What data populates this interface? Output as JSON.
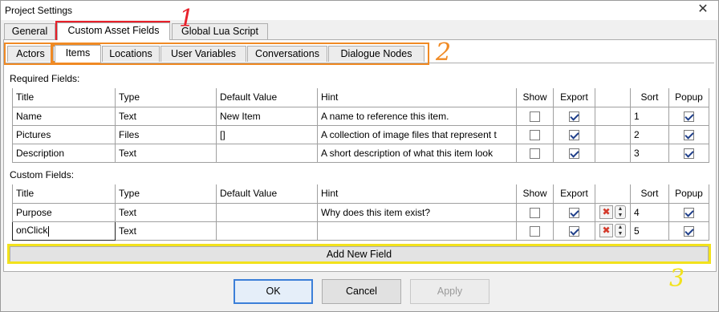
{
  "window": {
    "title": "Project Settings",
    "close_glyph": "✕"
  },
  "outer_tabs": [
    {
      "label": "General"
    },
    {
      "label": "Custom Asset Fields",
      "active": true
    },
    {
      "label": "Global Lua Script"
    }
  ],
  "inner_tabs": [
    {
      "label": "Actors"
    },
    {
      "label": "Items",
      "active": true
    },
    {
      "label": "Locations"
    },
    {
      "label": "User Variables"
    },
    {
      "label": "Conversations"
    },
    {
      "label": "Dialogue Nodes"
    }
  ],
  "required_section": {
    "label": "Required Fields:",
    "headers": [
      "Title",
      "Type",
      "Default Value",
      "Hint",
      "Show",
      "Export",
      "",
      "Sort",
      "Popup"
    ],
    "rows": [
      {
        "title": "Name",
        "type": "Text",
        "default": "New Item",
        "hint": "A name to reference this item.",
        "show": false,
        "export": true,
        "sort": "1",
        "popup": true
      },
      {
        "title": "Pictures",
        "type": "Files",
        "default": "[]",
        "hint": "A collection of image files that represent t",
        "show": false,
        "export": true,
        "sort": "2",
        "popup": true
      },
      {
        "title": "Description",
        "type": "Text",
        "default": "",
        "hint": "A short description of what this item look",
        "show": false,
        "export": true,
        "sort": "3",
        "popup": true
      }
    ]
  },
  "custom_section": {
    "label": "Custom Fields:",
    "headers": [
      "Title",
      "Type",
      "Default Value",
      "Hint",
      "Show",
      "Export",
      "",
      "Sort",
      "Popup"
    ],
    "rows": [
      {
        "title": "Purpose",
        "type": "Text",
        "default": "",
        "hint": "Why does this item exist?",
        "show": false,
        "export": true,
        "sort": "4",
        "popup": true
      },
      {
        "title": "onClick",
        "type": "Text",
        "default": "",
        "hint": "",
        "show": false,
        "export": true,
        "sort": "5",
        "popup": true
      }
    ],
    "delete_glyph": "✖",
    "up_glyph": "▲",
    "down_glyph": "▼"
  },
  "add_field_button": "Add New Field",
  "footer": {
    "ok": "OK",
    "cancel": "Cancel",
    "apply": "Apply"
  },
  "annotations": [
    {
      "number": "1",
      "color": "#e8202a"
    },
    {
      "number": "2",
      "color": "#f08a24"
    },
    {
      "number": "3",
      "color": "#f2e21c"
    }
  ]
}
